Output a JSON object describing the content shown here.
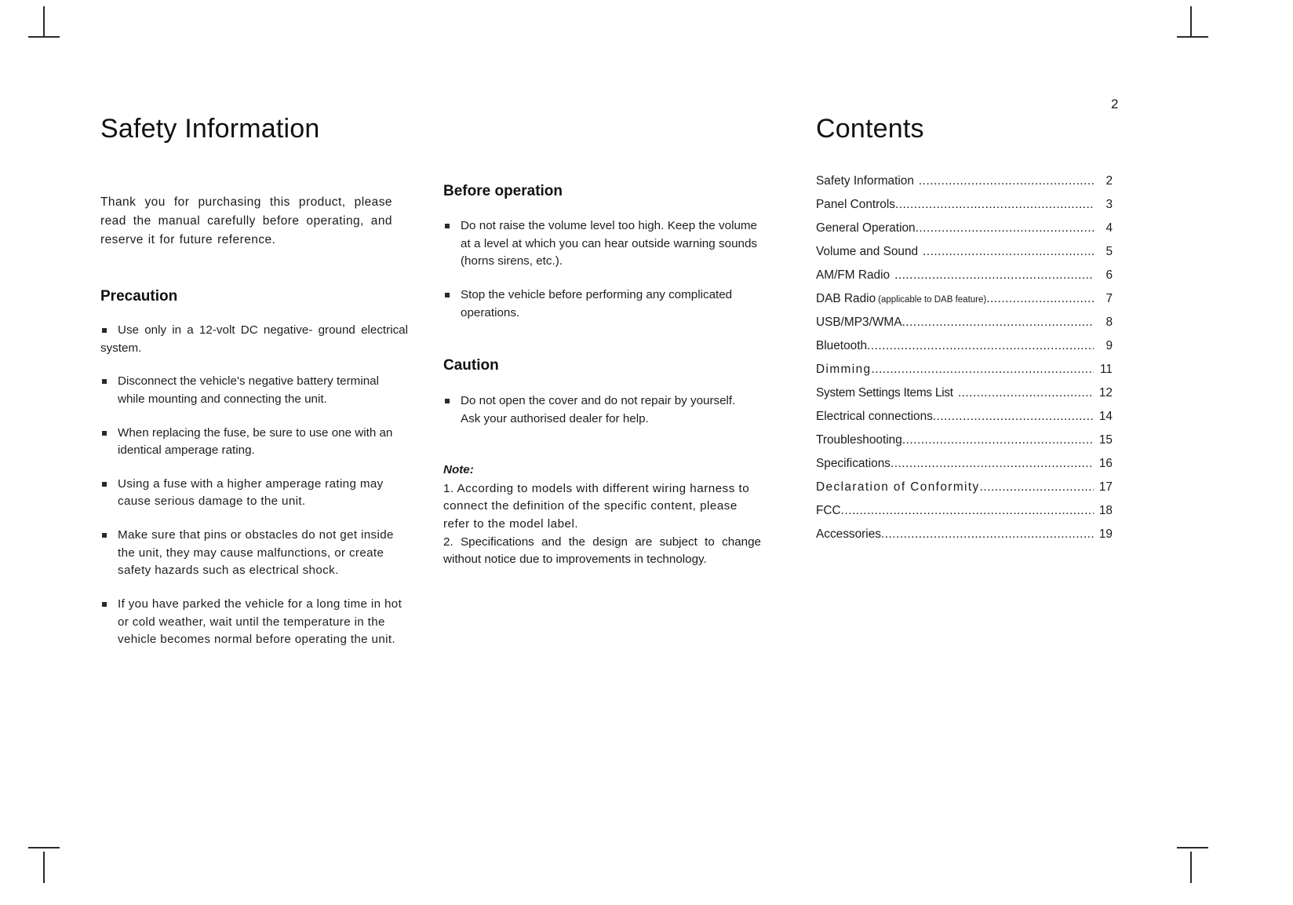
{
  "page": {
    "number": "2"
  },
  "left_column": {
    "title": "Safety Information",
    "intro": "Thank you for purchasing this product, please read the manual carefully before operating, and reserve it for future reference.",
    "precaution_heading": "Precaution",
    "precaution_items": [
      "Use only in a 12-volt DC  negative- ground electrical system.",
      "Disconnect the vehicle's negative battery terminal while mounting and connecting the unit.",
      "When replacing the fuse, be sure to use one with an identical amperage rating.",
      "Using a fuse with a higher amperage rating may cause serious damage to the unit.",
      "Make sure that pins or obstacles do not get inside the unit, they may cause malfunctions, or create safety hazards such as electrical shock.",
      "If you have parked the vehicle for a long time in hot or cold weather, wait until the temperature in the vehicle becomes normal before operating the unit."
    ]
  },
  "middle_column": {
    "before_operation_heading": "Before operation",
    "before_operation_items": [
      "Do not raise the volume level too high. Keep the volume at a level at which you can hear outside warning sounds  (horns sirens, etc.).",
      "Stop the vehicle before performing any complicated operations."
    ],
    "caution_heading": "Caution",
    "caution_items": [
      "Do not open the cover and do not repair by yourself.  Ask your authorised dealer for help."
    ],
    "note_label": "Note:",
    "note_items": [
      "1. According to models with different wiring harness to connect the definition of the specific content, please refer to the model label.",
      "2. Specifications and the design are subject to change without notice due to improvements in technology."
    ]
  },
  "right_column": {
    "title": "Contents",
    "toc": [
      {
        "label": "Safety Information",
        "sub": "",
        "page": "2"
      },
      {
        "label": "Panel Controls",
        "sub": "",
        "page": "3"
      },
      {
        "label": "General Operation",
        "sub": "",
        "page": "4"
      },
      {
        "label": "Volume and Sound",
        "sub": "",
        "page": "5"
      },
      {
        "label": "AM/FM Radio",
        "sub": "",
        "page": "6"
      },
      {
        "label": "DAB Radio",
        "sub": "(applicable to DAB feature)",
        "page": "7"
      },
      {
        "label": "USB/MP3/WMA",
        "sub": "",
        "page": "8"
      },
      {
        "label": "Bluetooth",
        "sub": "",
        "page": "9"
      },
      {
        "label": "Dimming",
        "sub": "",
        "page": "11"
      },
      {
        "label": "System Settings Items List",
        "sub": "",
        "page": "12"
      },
      {
        "label": "Electrical connections",
        "sub": "",
        "page": "14"
      },
      {
        "label": "Troubleshooting",
        "sub": "",
        "page": "15"
      },
      {
        "label": "Specifications",
        "sub": "",
        "page": "16"
      },
      {
        "label": "Declaration of Conformity",
        "sub": "",
        "page": "17"
      },
      {
        "label": "FCC",
        "sub": "",
        "page": "18"
      },
      {
        "label": "Accessories",
        "sub": "",
        "page": "19"
      }
    ]
  }
}
